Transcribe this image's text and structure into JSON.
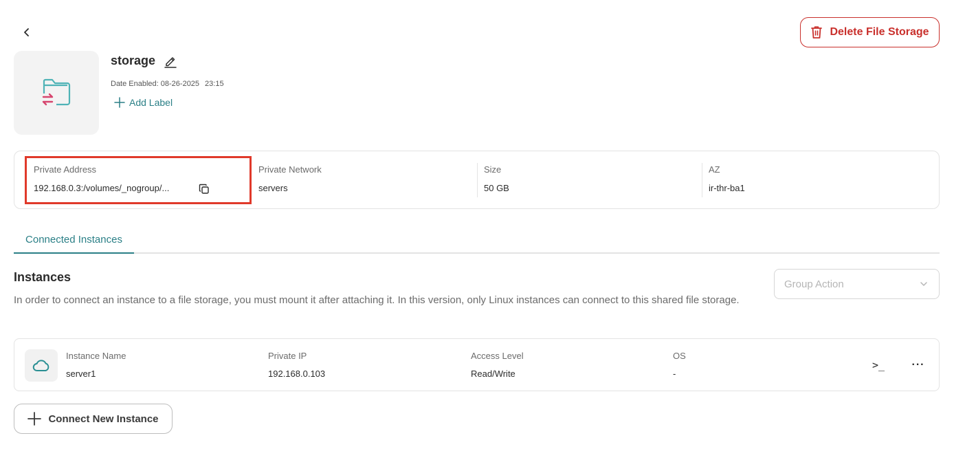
{
  "colors": {
    "accent": "#2a7f86",
    "danger": "#c9302c",
    "highlight": "#e0392a",
    "folder_icon": "#4fb3b6",
    "transfer_icon": "#d6456e"
  },
  "header": {
    "delete_label": "Delete File Storage",
    "title": "storage",
    "date_label": "Date Enabled: 08-26-2025",
    "date_time": "23:15",
    "add_label": "Add Label"
  },
  "info": {
    "private_address": {
      "label": "Private Address",
      "value": "192.168.0.3:/volumes/_nogroup/..."
    },
    "private_network": {
      "label": "Private Network",
      "value": "servers"
    },
    "size": {
      "label": "Size",
      "value": "50 GB"
    },
    "az": {
      "label": "AZ",
      "value": "ir-thr-ba1"
    }
  },
  "tabs": [
    {
      "label": "Connected Instances",
      "active": true
    }
  ],
  "instances_section": {
    "title": "Instances",
    "description": "In order to connect an instance to a file storage, you must mount it after attaching it. In this version, only Linux instances can connect to this shared file storage.",
    "group_action_placeholder": "Group Action"
  },
  "instances": [
    {
      "name_label": "Instance Name",
      "name": "server1",
      "ip_label": "Private IP",
      "ip": "192.168.0.103",
      "access_label": "Access Level",
      "access": "Read/Write",
      "os_label": "OS",
      "os": "-",
      "terminal_glyph": ">_",
      "more_glyph": "···"
    }
  ],
  "connect_button_label": "Connect New Instance",
  "icons": {
    "back": "chevron-left-icon",
    "delete": "trash-icon",
    "edit": "pencil-icon",
    "add": "plus-icon",
    "copy": "copy-icon",
    "dropdown": "chevron-down-icon",
    "instance": "cloud-icon",
    "thumbnail": "folder-transfer-icon"
  }
}
